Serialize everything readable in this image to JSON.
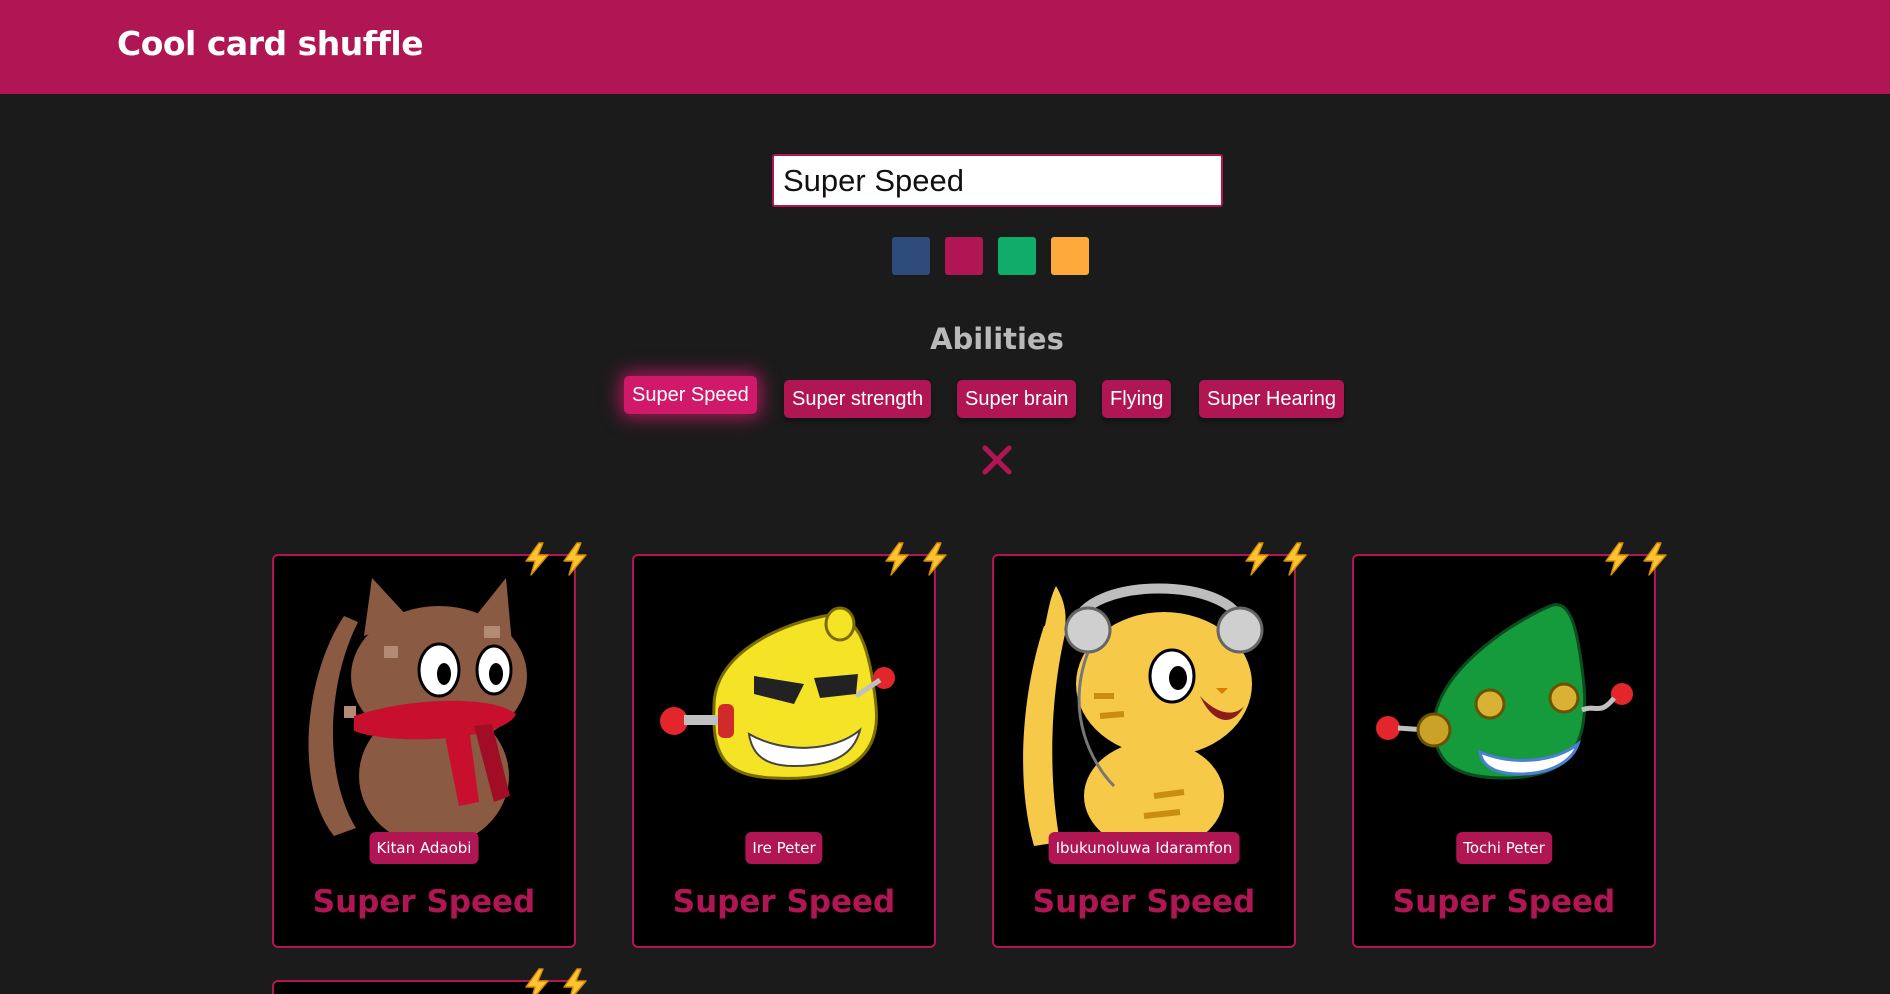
{
  "app": {
    "title": "Cool card shuffle"
  },
  "search": {
    "value": "Super Speed"
  },
  "colors": {
    "accent": "#b01554",
    "background": "#1b1b1b",
    "swatches": [
      "#2f4b7c",
      "#b01554",
      "#10ad6a",
      "#fda93c"
    ],
    "bolt": "#ffc233"
  },
  "abilities": {
    "heading": "Abilities",
    "items": [
      {
        "label": "Super Speed",
        "active": true
      },
      {
        "label": "Super strength",
        "active": false
      },
      {
        "label": "Super brain",
        "active": false
      },
      {
        "label": "Flying",
        "active": false
      },
      {
        "label": "Super Hearing",
        "active": false
      }
    ],
    "clear_icon": "close-icon"
  },
  "cards": [
    {
      "name": "Kitan Adaobi",
      "ability": "Super Speed",
      "avatar": "brown-cat-with-scarf",
      "bolts": 2
    },
    {
      "name": "Ire Peter",
      "ability": "Super Speed",
      "avatar": "yellow-robot-head",
      "bolts": 2
    },
    {
      "name": "Ibukunoluwa Idaramfon",
      "ability": "Super Speed",
      "avatar": "yellow-tiger-with-headphones",
      "bolts": 2
    },
    {
      "name": "Tochi Peter",
      "ability": "Super Speed",
      "avatar": "green-robot-head",
      "bolts": 2
    }
  ]
}
